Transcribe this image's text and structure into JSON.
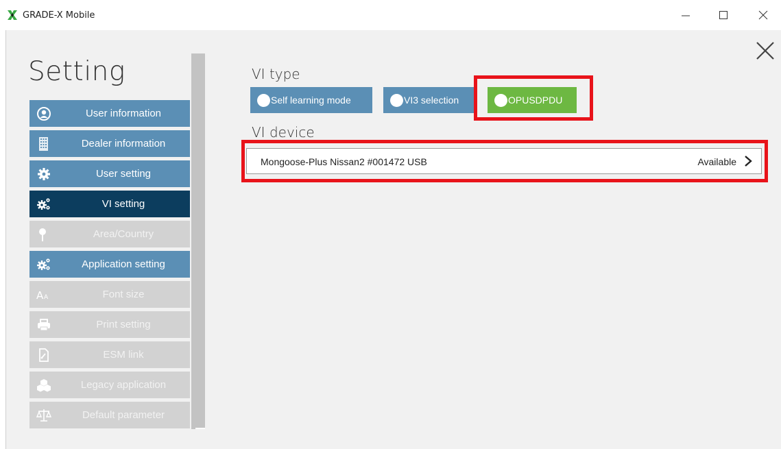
{
  "window": {
    "title": "GRADE-X Mobile",
    "app_icon": "grade-x-logo-icon",
    "controls": [
      "minimize-icon",
      "maximize-icon",
      "close-icon"
    ]
  },
  "page": {
    "title": "Setting",
    "close_icon": "close-icon"
  },
  "sidebar": {
    "items": [
      {
        "label": "User information",
        "icon": "user-circle-icon",
        "state": "enabled"
      },
      {
        "label": "Dealer information",
        "icon": "building-icon",
        "state": "enabled"
      },
      {
        "label": "User setting",
        "icon": "gear-icon",
        "state": "enabled"
      },
      {
        "label": "VI setting",
        "icon": "gears-icon",
        "state": "selected"
      },
      {
        "label": "Area/Country",
        "icon": "map-pin-icon",
        "state": "disabled"
      },
      {
        "label": "Application setting",
        "icon": "gears-icon",
        "state": "enabled"
      },
      {
        "label": "Font size",
        "icon": "font-size-icon",
        "state": "disabled"
      },
      {
        "label": "Print setting",
        "icon": "printer-icon",
        "state": "disabled"
      },
      {
        "label": "ESM link",
        "icon": "document-link-icon",
        "state": "disabled"
      },
      {
        "label": "Legacy application",
        "icon": "cubes-icon",
        "state": "disabled"
      },
      {
        "label": "Default parameter",
        "icon": "balance-scale-icon",
        "state": "disabled"
      }
    ]
  },
  "vi_type": {
    "label": "VI type",
    "options": [
      {
        "label": "Self learning mode",
        "selected": false
      },
      {
        "label": "VI3 selection",
        "selected": false
      },
      {
        "label": "OPUSDPDU",
        "selected": true
      }
    ]
  },
  "vi_device": {
    "label": "VI device",
    "name": "Mongoose-Plus Nissan2 #001472 USB",
    "status": "Available",
    "icon": "chevron-right-icon"
  },
  "colors": {
    "menu_active": "#5b8fb5",
    "menu_selected": "#0c3d5e",
    "menu_disabled": "#d2d2d2",
    "option_selected": "#6db842",
    "highlight": "#e8131a",
    "background": "#f1f1f1"
  }
}
